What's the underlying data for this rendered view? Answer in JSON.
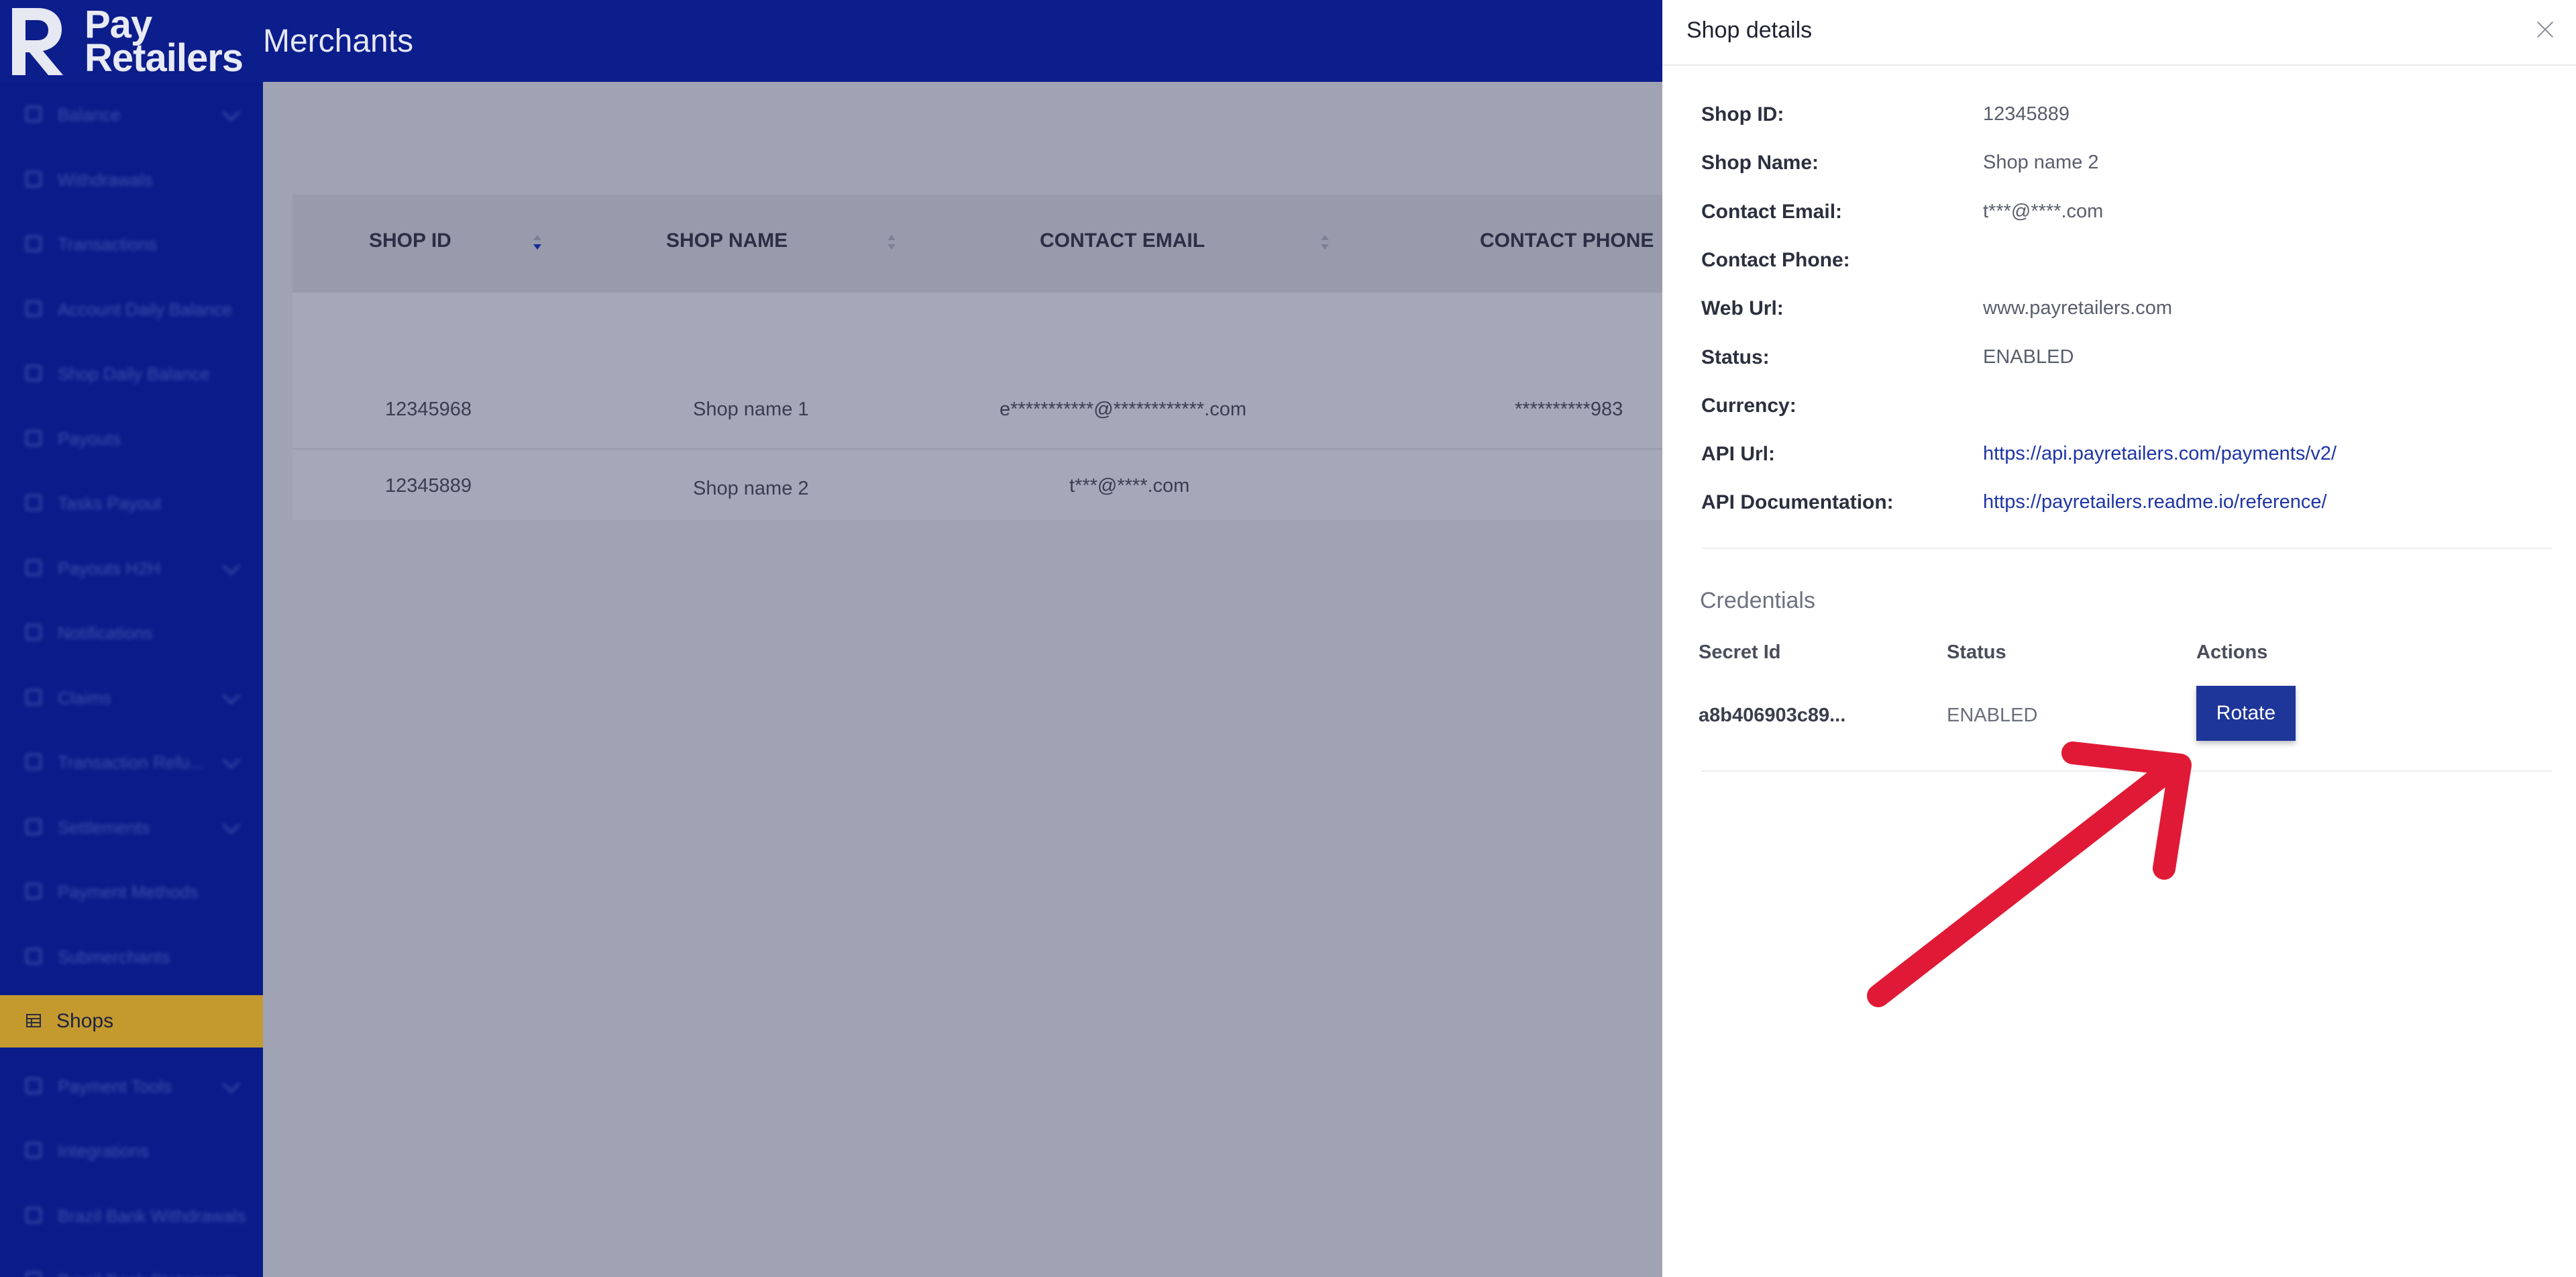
{
  "header": {
    "logo_line1": "Pay",
    "logo_line2": "Retailers",
    "title": "Merchants"
  },
  "sidebar": {
    "items": [
      {
        "label": "Balance",
        "icon": "balance-icon",
        "chevron": true
      },
      {
        "label": "Withdrawals",
        "icon": "withdrawals-icon",
        "chevron": false
      },
      {
        "label": "Transactions",
        "icon": "transactions-icon",
        "chevron": false
      },
      {
        "label": "Account Daily Balance",
        "icon": "account-balance-icon",
        "chevron": false
      },
      {
        "label": "Shop Daily Balance",
        "icon": "shop-balance-icon",
        "chevron": false
      },
      {
        "label": "Payouts",
        "icon": "payouts-icon",
        "chevron": false
      },
      {
        "label": "Tasks Payout",
        "icon": "tasks-icon",
        "chevron": false
      },
      {
        "label": "Payouts H2H",
        "icon": "payouts-h2h-icon",
        "chevron": true
      },
      {
        "label": "Notifications",
        "icon": "notifications-icon",
        "chevron": false
      },
      {
        "label": "Claims",
        "icon": "claims-icon",
        "chevron": true
      },
      {
        "label": "Transaction Refu...",
        "icon": "refund-icon",
        "chevron": true
      },
      {
        "label": "Settlements",
        "icon": "settlements-icon",
        "chevron": true
      },
      {
        "label": "Payment Methods",
        "icon": "payment-methods-icon",
        "chevron": false
      },
      {
        "label": "Submerchants",
        "icon": "submerchants-icon",
        "chevron": false
      },
      {
        "label": "Shops",
        "icon": "shops-icon",
        "chevron": false,
        "active": true
      },
      {
        "label": "Payment Tools",
        "icon": "payment-tools-icon",
        "chevron": true
      },
      {
        "label": "Integrations",
        "icon": "integrations-icon",
        "chevron": false
      },
      {
        "label": "Brazil Bank Withdrawals",
        "icon": "bank-withdrawals-icon",
        "chevron": false
      },
      {
        "label": "Brazil Bank Statements",
        "icon": "bank-statements-icon",
        "chevron": false
      }
    ]
  },
  "table": {
    "columns": [
      "SHOP ID",
      "SHOP NAME",
      "CONTACT EMAIL",
      "CONTACT PHONE"
    ],
    "rows": [
      {
        "shop_id": "12345968",
        "shop_name": "Shop name 1",
        "email": "e***********@************.com",
        "phone": "**********983"
      },
      {
        "shop_id": "12345889",
        "shop_name": "Shop name 2",
        "email": "t***@****.com",
        "phone": ""
      }
    ]
  },
  "drawer": {
    "title": "Shop details",
    "fields": [
      {
        "label": "Shop ID:",
        "value": "12345889"
      },
      {
        "label": "Shop Name:",
        "value": "Shop name 2"
      },
      {
        "label": "Contact Email:",
        "value": "t***@****.com"
      },
      {
        "label": "Contact Phone:",
        "value": ""
      },
      {
        "label": "Web Url:",
        "value": "www.payretailers.com"
      },
      {
        "label": "Status:",
        "value": "ENABLED"
      },
      {
        "label": "Currency:",
        "value": ""
      },
      {
        "label": "API Url:",
        "value": "https://api.payretailers.com/payments/v2/",
        "link": true
      },
      {
        "label": "API Documentation:",
        "value": "https://payretailers.readme.io/reference/",
        "link": true
      }
    ],
    "credentials": {
      "title": "Credentials",
      "headers": {
        "secret_id": "Secret Id",
        "status": "Status",
        "actions": "Actions"
      },
      "row": {
        "secret_id": "a8b406903c89...",
        "status": "ENABLED",
        "action_label": "Rotate"
      }
    }
  },
  "colors": {
    "header_bg": "#0c1d8c",
    "sidebar_active": "#c49a2f",
    "primary_button": "#1e3599",
    "link": "#1f35a3",
    "annotation_arrow": "#e01a36"
  }
}
